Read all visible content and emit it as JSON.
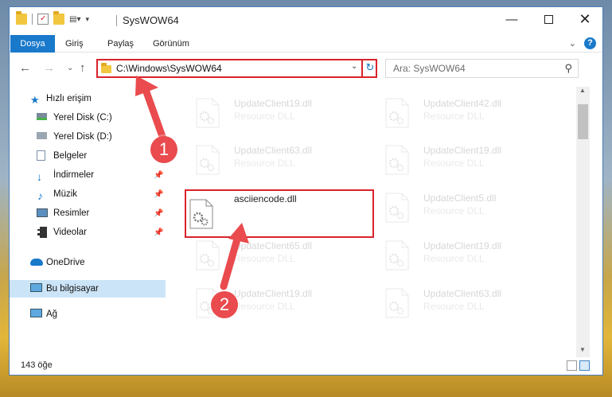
{
  "window": {
    "title": "SysWOW64"
  },
  "ribbon": {
    "tabs": [
      "Dosya",
      "Giriş",
      "Paylaş",
      "Görünüm"
    ]
  },
  "address": {
    "path": "C:\\Windows\\SysWOW64"
  },
  "search": {
    "placeholder": "Ara: SysWOW64"
  },
  "navpane": {
    "items": [
      {
        "label": "Hızlı erişim",
        "icon": "star-icon"
      },
      {
        "label": "Yerel Disk (C:)",
        "icon": "drive-icon"
      },
      {
        "label": "Yerel Disk (D:)",
        "icon": "drive-icon"
      },
      {
        "label": "Belgeler",
        "icon": "documents-icon"
      },
      {
        "label": "İndirmeler",
        "icon": "downloads-icon"
      },
      {
        "label": "Müzik",
        "icon": "music-icon"
      },
      {
        "label": "Resimler",
        "icon": "pictures-icon"
      },
      {
        "label": "Videolar",
        "icon": "videos-icon"
      },
      {
        "label": "OneDrive",
        "icon": "cloud-icon"
      },
      {
        "label": "Bu bilgisayar",
        "icon": "computer-icon"
      },
      {
        "label": "Ağ",
        "icon": "network-icon"
      }
    ]
  },
  "files": [
    {
      "name": "UpdateClient19.dll",
      "type": "Resource DLL",
      "faded": true
    },
    {
      "name": "UpdateClient42.dll",
      "type": "Resource DLL",
      "faded": true
    },
    {
      "name": "UpdateClient63.dll",
      "type": "Resource DLL",
      "faded": true
    },
    {
      "name": "UpdateClient19.dll",
      "type": "Resource DLL",
      "faded": true
    },
    {
      "name": "asciiencode.dll",
      "type": "",
      "faded": false
    },
    {
      "name": "UpdateClient5.dll",
      "type": "Resource DLL",
      "faded": true
    },
    {
      "name": "UpdateClient65.dll",
      "type": "Resource DLL",
      "faded": true
    },
    {
      "name": "UpdateClient19.dll",
      "type": "Resource DLL",
      "faded": true
    },
    {
      "name": "UpdateClient19.dll",
      "type": "Resource DLL",
      "faded": true
    },
    {
      "name": "UpdateClient63.dll",
      "type": "Resource DLL",
      "faded": true
    }
  ],
  "status": {
    "count": "143 öğe"
  },
  "annotations": {
    "step1": "1",
    "step2": "2",
    "color": "#e94b4e"
  }
}
